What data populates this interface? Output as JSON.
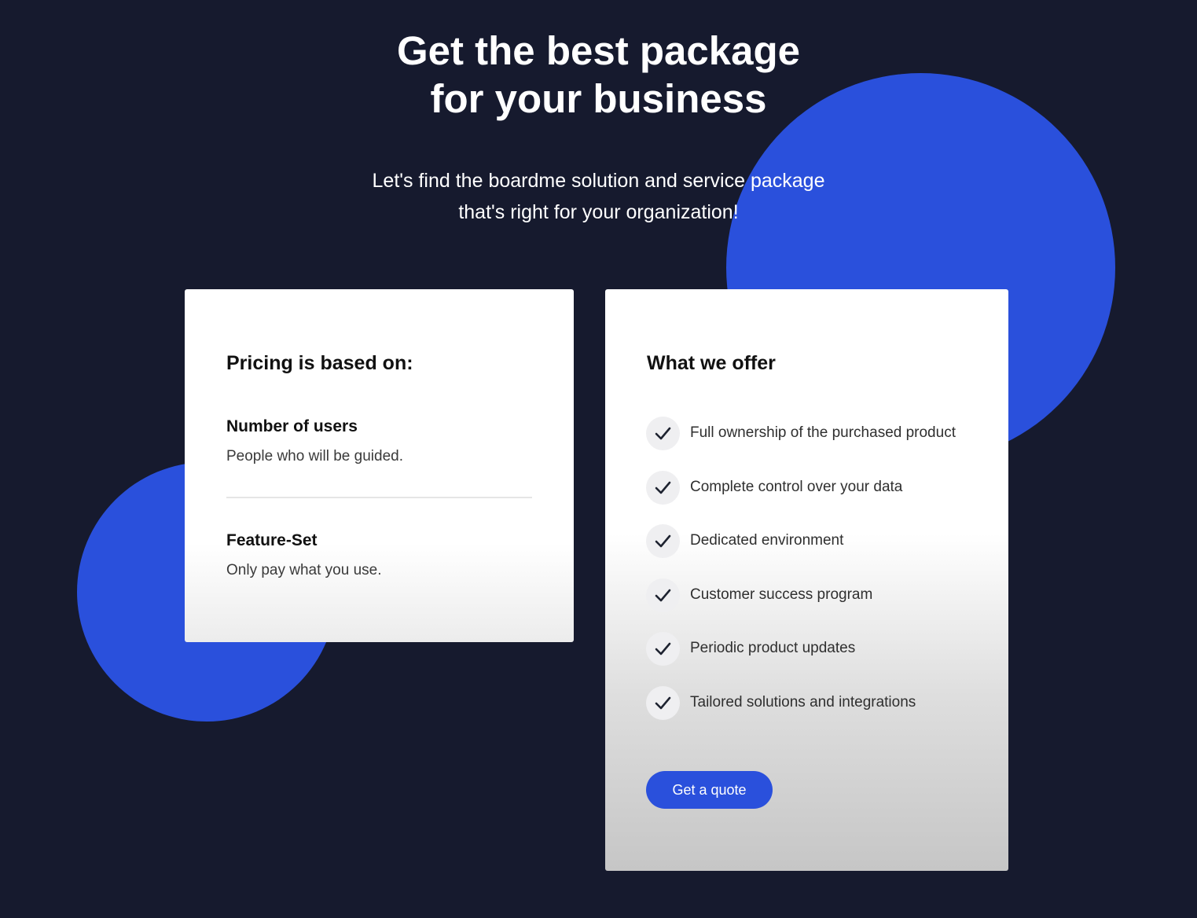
{
  "hero": {
    "title_line1": "Get the best package",
    "title_line2": "for your business",
    "subtitle_line1": "Let's find the boardme solution and service package",
    "subtitle_line2": "that's right for your organization!"
  },
  "pricing_card": {
    "title": "Pricing is based on:",
    "criteria": [
      {
        "title": "Number of users",
        "description": "People who will be guided."
      },
      {
        "title": "Feature-Set",
        "description": "Only pay what you use."
      }
    ]
  },
  "offer_card": {
    "title": "What we offer",
    "items": [
      {
        "label": "Full ownership of the purchased product",
        "icon": "check-icon"
      },
      {
        "label": "Complete control over your data",
        "icon": "check-icon"
      },
      {
        "label": "Dedicated environment",
        "icon": "check-icon"
      },
      {
        "label": "Customer success program",
        "icon": "check-icon"
      },
      {
        "label": "Periodic product updates",
        "icon": "check-icon"
      },
      {
        "label": "Tailored solutions and integrations",
        "icon": "check-icon"
      }
    ],
    "button_label": "Get a quote"
  },
  "colors": {
    "background": "#161a2e",
    "accent": "#2a50dc",
    "card": "#ffffff"
  }
}
